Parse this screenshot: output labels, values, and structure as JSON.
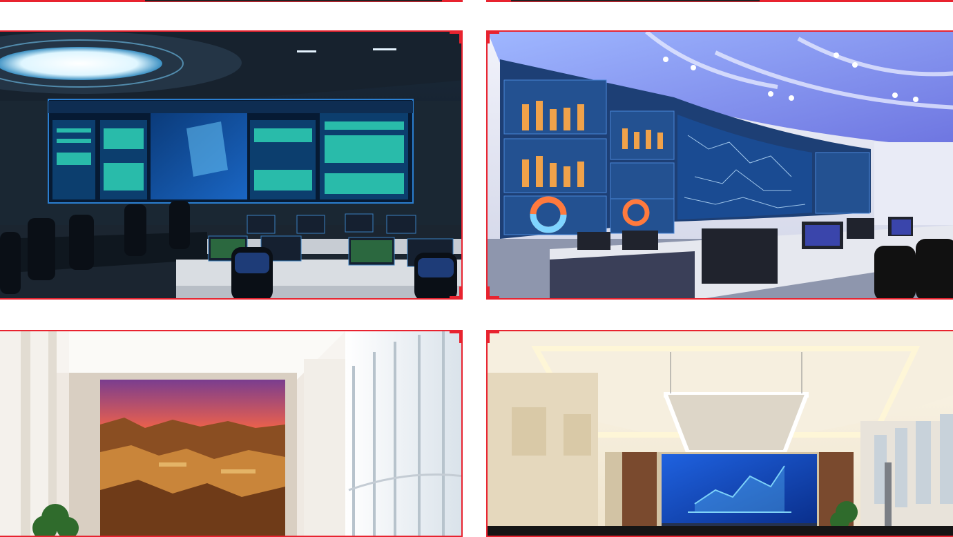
{
  "tiles": [
    {
      "name": "control-room-dark",
      "alt": ""
    },
    {
      "name": "control-room-curved",
      "alt": ""
    },
    {
      "name": "lobby-landscape-wall",
      "alt": ""
    },
    {
      "name": "meeting-room-screen",
      "alt": ""
    }
  ],
  "colors": {
    "frame": "#e8232f",
    "background": "#ffffff"
  }
}
